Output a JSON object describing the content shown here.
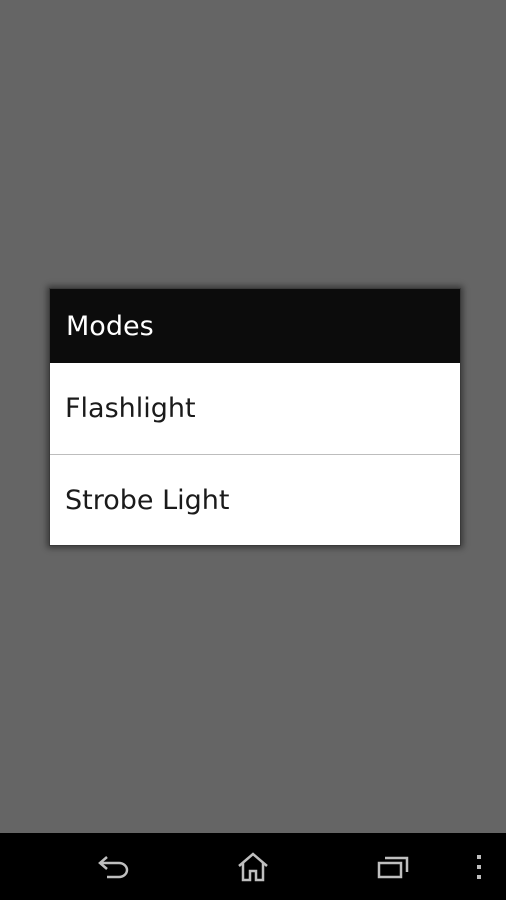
{
  "dialog": {
    "title": "Modes",
    "items": [
      {
        "label": "Flashlight"
      },
      {
        "label": "Strobe Light"
      }
    ]
  },
  "navbar": {
    "buttons": [
      {
        "icon": "back-icon"
      },
      {
        "icon": "home-icon"
      },
      {
        "icon": "recents-icon"
      },
      {
        "icon": "overflow-menu-icon"
      }
    ]
  },
  "colors": {
    "scrim": "#656565",
    "title_bar": "#0c0c0c",
    "navbar": "#000000",
    "dialog_bg": "#ffffff"
  }
}
